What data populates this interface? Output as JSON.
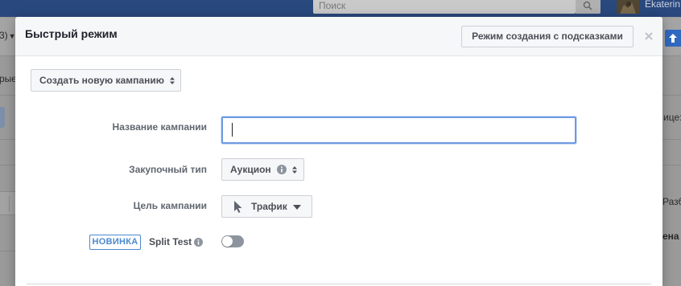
{
  "background": {
    "search_placeholder": "Поиск",
    "user_name": "Ekaterin",
    "left_fragments": [
      "3)",
      "рые"
    ],
    "right_fragments": [
      "ице:",
      "Разб",
      "ена"
    ]
  },
  "modal": {
    "title": "Быстрый режим",
    "guided_mode_button": "Режим создания с подсказками",
    "close_icon": "close-icon",
    "campaign_select": "Создать новую кампанию",
    "campaign_name": {
      "label": "Название кампании",
      "value": "",
      "placeholder": ""
    },
    "buying_type": {
      "label": "Закупочный тип",
      "value": "Аукцион"
    },
    "objective": {
      "label": "Цель кампании",
      "value": "Трафик"
    },
    "split_test": {
      "badge": "НОВИНКА",
      "label": "Split Test",
      "enabled": false
    }
  },
  "colors": {
    "accent_blue": "#4b88cf",
    "focus_border": "#6d9be0",
    "header_bg": "#f6f7f9",
    "toggle_off": "#8d949e",
    "topbar": "#29487d"
  }
}
